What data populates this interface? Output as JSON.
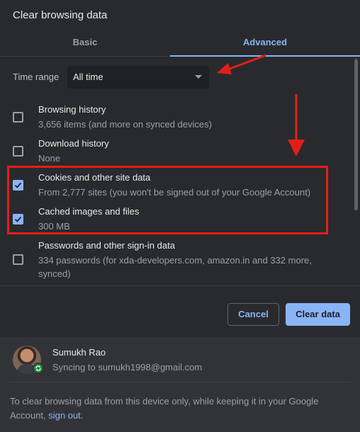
{
  "dialog": {
    "title": "Clear browsing data"
  },
  "tabs": [
    {
      "label": "Basic",
      "selected": false
    },
    {
      "label": "Advanced",
      "selected": true
    }
  ],
  "time_range": {
    "label": "Time range",
    "value": "All time"
  },
  "items": [
    {
      "title": "Browsing history",
      "subtitle": "3,656 items (and more on synced devices)",
      "checked": false
    },
    {
      "title": "Download history",
      "subtitle": "None",
      "checked": false
    },
    {
      "title": "Cookies and other site data",
      "subtitle": "From 2,777 sites (you won't be signed out of your Google Account)",
      "checked": true
    },
    {
      "title": "Cached images and files",
      "subtitle": "300 MB",
      "checked": true
    },
    {
      "title": "Passwords and other sign-in data",
      "subtitle": "334 passwords (for xda-developers.com, amazon.in and 332 more, synced)",
      "checked": false
    }
  ],
  "buttons": {
    "cancel": "Cancel",
    "clear": "Clear data"
  },
  "account": {
    "name": "Sumukh Rao",
    "sync_status": "Syncing to sumukh1998@gmail.com"
  },
  "footer": {
    "note_prefix": "To clear browsing data from this device only, while keeping it in your Google Account,",
    "link_text": "sign out",
    "note_suffix": "."
  },
  "colors": {
    "background": "#292a2d",
    "accent": "#8ab4f8",
    "annotation_red": "#e21f17"
  },
  "icons": {
    "dropdown": "chevron-down-icon",
    "check": "check-icon",
    "sync": "sync-icon"
  }
}
